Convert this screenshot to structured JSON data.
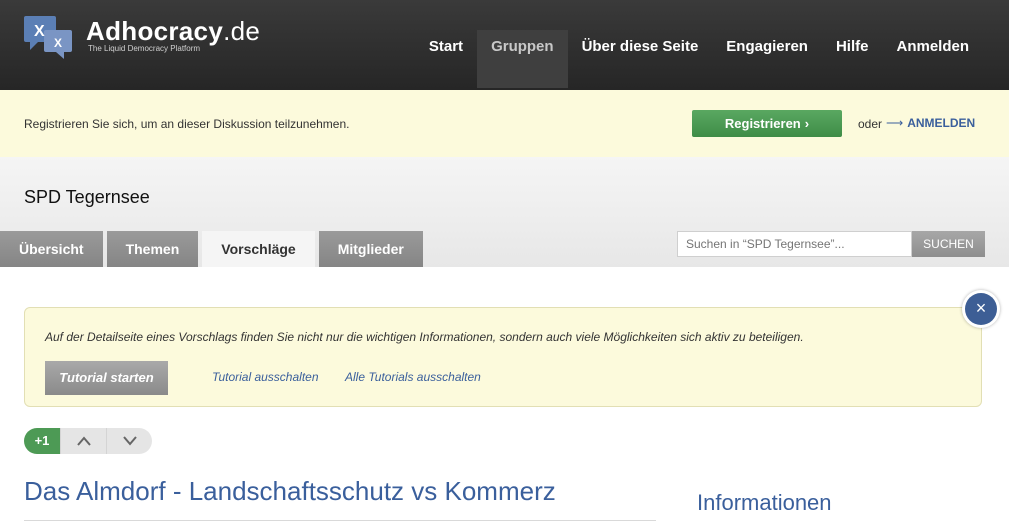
{
  "header": {
    "brand_name": "Adhocracy",
    "brand_tld": ".de",
    "tagline": "The Liquid Democracy Platform",
    "nav": [
      {
        "label": "Start"
      },
      {
        "label": "Gruppen"
      },
      {
        "label": "Über diese Seite"
      },
      {
        "label": "Engagieren"
      },
      {
        "label": "Hilfe"
      },
      {
        "label": "Anmelden"
      }
    ],
    "active_nav": "Gruppen"
  },
  "notice": {
    "text": "Registrieren Sie sich, um an dieser Diskussion teilzunehmen.",
    "register_label": "Registrieren",
    "or_label": "oder",
    "login_label": "ANMELDEN"
  },
  "group": {
    "title": "SPD Tegernsee",
    "tabs": [
      {
        "label": "Übersicht"
      },
      {
        "label": "Themen"
      },
      {
        "label": "Vorschläge"
      },
      {
        "label": "Mitglieder"
      }
    ],
    "active_tab": "Vorschläge",
    "search_placeholder": "Suchen in “SPD Tegernsee”...",
    "search_button": "SUCHEN"
  },
  "tutorial": {
    "text": "Auf der Detailseite eines Vorschlags finden Sie nicht nur die wichtigen Informationen, sondern auch viele Möglichkeiten sich aktiv zu beteiligen.",
    "start_label": "Tutorial starten",
    "disable_label": "Tutorial ausschalten",
    "disable_all_label": "Alle Tutorials ausschalten"
  },
  "proposal": {
    "score": "+1",
    "title": "Das Almdorf - Landschaftsschutz vs Kommerz",
    "sidebar_heading": "Informationen"
  },
  "colors": {
    "header_bg": "#2e2e2e",
    "notice_bg": "#fcfadc",
    "green": "#4d9a55",
    "link_blue": "#3a5f9c"
  }
}
